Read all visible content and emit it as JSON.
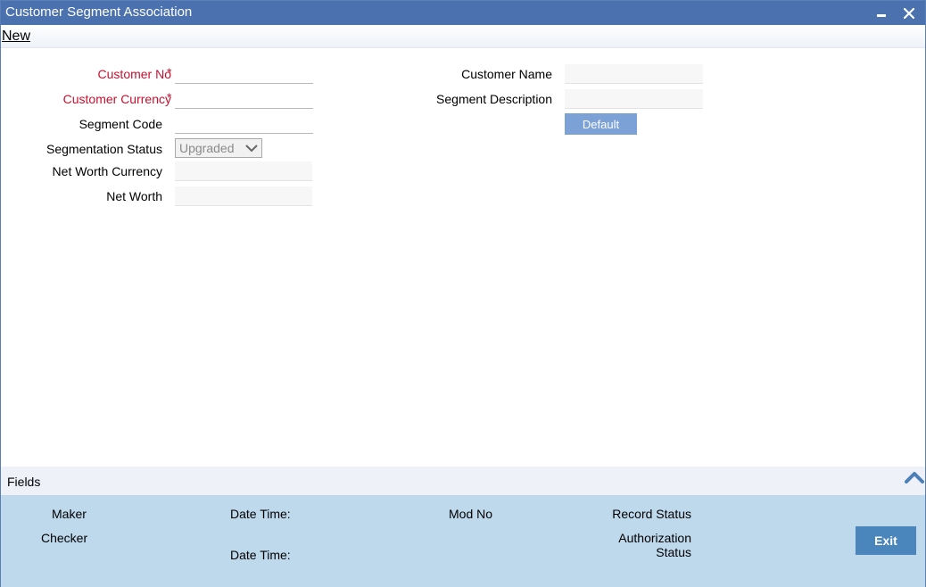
{
  "window": {
    "title": "Customer Segment Association",
    "minimize_icon": "minimize-icon",
    "close_icon": "close-icon"
  },
  "menu": {
    "new_label": "New"
  },
  "form": {
    "customer_no": {
      "label": "Customer No",
      "required": true,
      "value": ""
    },
    "customer_currency": {
      "label": "Customer Currency",
      "required": true,
      "value": ""
    },
    "segment_code": {
      "label": "Segment Code",
      "value": ""
    },
    "segmentation_status": {
      "label": "Segmentation Status",
      "value": "Upgraded"
    },
    "net_worth_currency": {
      "label": "Net Worth Currency",
      "value": ""
    },
    "net_worth": {
      "label": "Net Worth",
      "value": ""
    },
    "customer_name": {
      "label": "Customer Name",
      "value": ""
    },
    "segment_description": {
      "label": "Segment Description",
      "value": ""
    },
    "default_button": "Default"
  },
  "required_marker": "*",
  "fields_bar": {
    "label": "Fields",
    "toggle_icon": "chevron-up-icon"
  },
  "footer": {
    "maker": "Maker",
    "checker": "Checker",
    "date_time_1": "Date Time:",
    "date_time_2": "Date Time:",
    "mod_no": "Mod No",
    "record_status": "Record Status",
    "authorization_status_line1": "Authorization",
    "authorization_status_line2": "Status",
    "exit_button": "Exit"
  },
  "colors": {
    "titlebar": "#4b72ae",
    "required_label": "#c8102e",
    "default_button": "#7ba1d6",
    "footer": "#bed8ec",
    "exit_button": "#4a86bc"
  }
}
